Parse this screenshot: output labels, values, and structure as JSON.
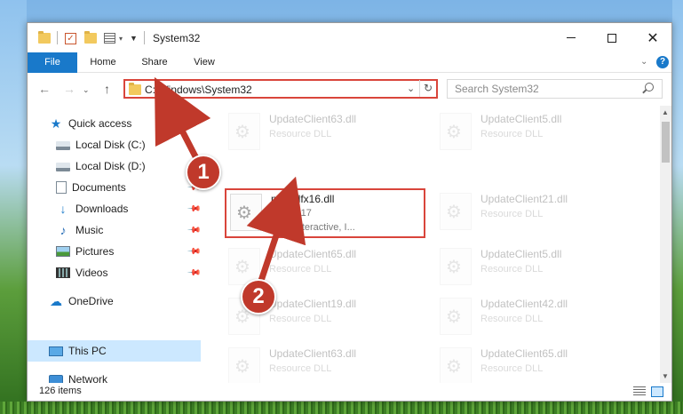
{
  "window": {
    "title": "System32"
  },
  "ribbon": {
    "tabs": [
      {
        "label": "File"
      },
      {
        "label": "Home"
      },
      {
        "label": "Share"
      },
      {
        "label": "View"
      }
    ],
    "help_label": "?"
  },
  "navbar": {
    "back": "←",
    "forward": "→",
    "up": "↑",
    "address": "C:\\Windows\\System32",
    "refresh": "↻",
    "search_placeholder": "Search System32"
  },
  "sidebar": {
    "items": [
      {
        "label": "Quick access"
      },
      {
        "label": "Local Disk (C:)"
      },
      {
        "label": "Local Disk (D:)"
      },
      {
        "label": "Documents"
      },
      {
        "label": "Downloads"
      },
      {
        "label": "Music"
      },
      {
        "label": "Pictures"
      },
      {
        "label": "Videos"
      },
      {
        "label": "OneDrive"
      },
      {
        "label": "This PC"
      },
      {
        "label": "Network"
      }
    ]
  },
  "files": {
    "left": [
      {
        "name": "UpdateClient63.dll",
        "type": "Resource DLL"
      },
      {
        "name": "mm3dfx16.dll",
        "version": "4.10.1.17",
        "company": "3Dfx Interactive, I..."
      },
      {
        "name": "UpdateClient65.dll",
        "type": "Resource DLL"
      },
      {
        "name": "UpdateClient19.dll",
        "type": "Resource DLL"
      },
      {
        "name": "UpdateClient63.dll",
        "type": "Resource DLL"
      }
    ],
    "right": [
      {
        "name": "UpdateClient5.dll",
        "type": "Resource DLL"
      },
      {
        "name": "UpdateClient21.dll",
        "type": "Resource DLL"
      },
      {
        "name": "UpdateClient5.dll",
        "type": "Resource DLL"
      },
      {
        "name": "UpdateClient42.dll",
        "type": "Resource DLL"
      },
      {
        "name": "UpdateClient65.dll",
        "type": "Resource DLL"
      }
    ]
  },
  "status": {
    "item_count": "126 items"
  },
  "annotations": {
    "step1": "1",
    "step2": "2",
    "color": "#c0392b"
  }
}
